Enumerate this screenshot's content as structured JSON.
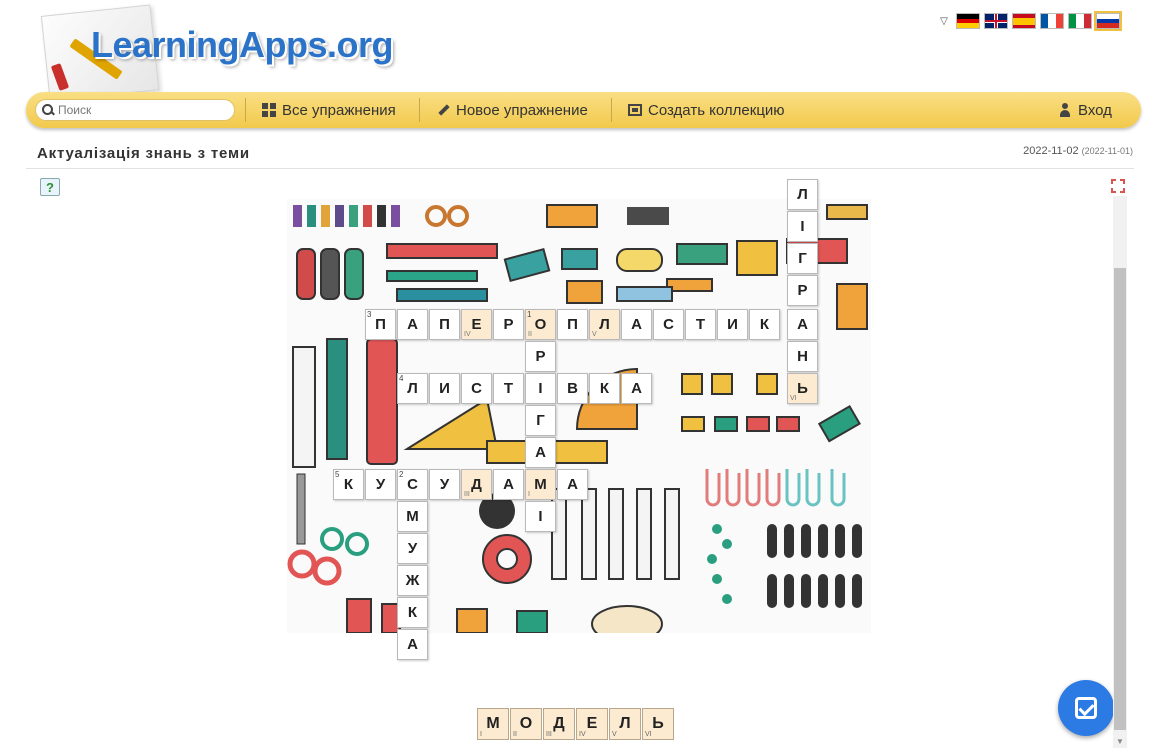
{
  "header": {
    "logo_text": "LearningApps.org",
    "languages": [
      {
        "name": "Deutsch",
        "icon": "flag-de"
      },
      {
        "name": "English",
        "icon": "flag-gb"
      },
      {
        "name": "Español",
        "icon": "flag-es"
      },
      {
        "name": "Français",
        "icon": "flag-fr"
      },
      {
        "name": "Italiano",
        "icon": "flag-it"
      },
      {
        "name": "Русский",
        "icon": "flag-ru",
        "selected": true
      }
    ]
  },
  "nav": {
    "search_placeholder": "Поиск",
    "all_exercises": "Все упражнения",
    "new_exercise": "Новое упражнение",
    "create_collection": "Создать коллекцию",
    "login": "Вход"
  },
  "page": {
    "title": "Актуалізація знань з теми",
    "date": "2022-11-02",
    "date_secondary": "(2022-11-01)"
  },
  "crossword": {
    "words": [
      {
        "number": "3",
        "direction": "across",
        "letters": [
          "П",
          "А",
          "П",
          "Е",
          "Р",
          "О",
          "П",
          "Л",
          "А",
          "С",
          "Т",
          "И",
          "К",
          "А"
        ]
      },
      {
        "number": "4",
        "direction": "across",
        "letters": [
          "Л",
          "И",
          "С",
          "Т",
          "І",
          "В",
          "К",
          "А"
        ]
      },
      {
        "number": "5",
        "direction": "across",
        "letters": [
          "К",
          "У",
          "С",
          "У",
          "Д",
          "А",
          "М",
          "А"
        ]
      },
      {
        "number": "1",
        "direction": "down",
        "letters": [
          "О",
          "Р",
          "І",
          "Г",
          "А",
          "М",
          "І"
        ]
      },
      {
        "number": "2",
        "direction": "down",
        "letters": [
          "С",
          "М",
          "У",
          "Ж",
          "К",
          "А"
        ]
      },
      {
        "number": "6",
        "direction": "down",
        "letters": [
          "Л",
          "І",
          "Г",
          "Р",
          "А",
          "Н",
          "Ь"
        ]
      }
    ],
    "cells": [
      {
        "letter": "Л"
      },
      {
        "letter": "І"
      },
      {
        "letter": "Г"
      },
      {
        "letter": "Р"
      },
      {
        "letter": "П",
        "num": "3"
      },
      {
        "letter": "А"
      },
      {
        "letter": "П"
      },
      {
        "letter": "Е",
        "mark": "IV"
      },
      {
        "letter": "Р"
      },
      {
        "letter": "О",
        "num": "1",
        "mark": "II"
      },
      {
        "letter": "П"
      },
      {
        "letter": "Л",
        "mark": "V"
      },
      {
        "letter": "А"
      },
      {
        "letter": "С"
      },
      {
        "letter": "Т"
      },
      {
        "letter": "И"
      },
      {
        "letter": "К"
      },
      {
        "letter": "А"
      },
      {
        "letter": "Н"
      },
      {
        "letter": "Ь",
        "mark": "VI"
      },
      {
        "letter": "Р"
      },
      {
        "letter": "Л",
        "num": "4"
      },
      {
        "letter": "И"
      },
      {
        "letter": "С"
      },
      {
        "letter": "Т"
      },
      {
        "letter": "І"
      },
      {
        "letter": "В"
      },
      {
        "letter": "К"
      },
      {
        "letter": "А"
      },
      {
        "letter": "Г"
      },
      {
        "letter": "А"
      },
      {
        "letter": "К",
        "num": "5"
      },
      {
        "letter": "У"
      },
      {
        "letter": "С",
        "num": "2"
      },
      {
        "letter": "У"
      },
      {
        "letter": "Д",
        "mark": "III"
      },
      {
        "letter": "А"
      },
      {
        "letter": "М",
        "mark": "I"
      },
      {
        "letter": "А"
      },
      {
        "letter": "І"
      },
      {
        "letter": "М"
      },
      {
        "letter": "У"
      },
      {
        "letter": "Ж"
      },
      {
        "letter": "К"
      },
      {
        "letter": "А"
      }
    ],
    "solution": [
      {
        "letter": "М",
        "mark": "I"
      },
      {
        "letter": "О",
        "mark": "II"
      },
      {
        "letter": "Д",
        "mark": "III"
      },
      {
        "letter": "Е",
        "mark": "IV"
      },
      {
        "letter": "Л",
        "mark": "V"
      },
      {
        "letter": "Ь",
        "mark": "VI"
      }
    ]
  }
}
